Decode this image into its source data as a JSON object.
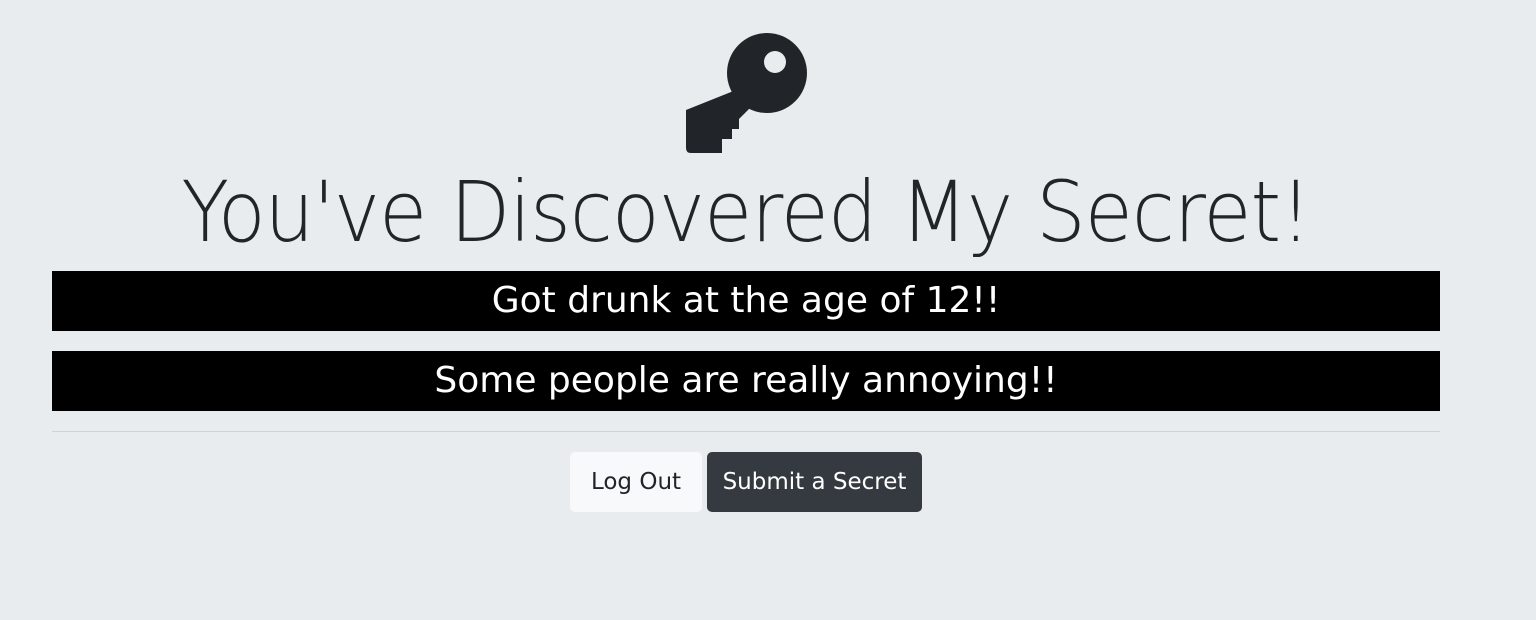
{
  "header": {
    "icon": "key-icon",
    "title": "You've Discovered My Secret!"
  },
  "secrets": [
    {
      "text": "Got drunk at the age of 12!!"
    },
    {
      "text": "Some people are really annoying!!"
    }
  ],
  "actions": {
    "logout_label": "Log Out",
    "submit_label": "Submit a Secret"
  },
  "colors": {
    "background": "#e9ecef",
    "text": "#212529",
    "secret_background": "#000000",
    "secret_text": "#ffffff",
    "logout_button": "#f8f9fa",
    "submit_button": "#343a40"
  }
}
